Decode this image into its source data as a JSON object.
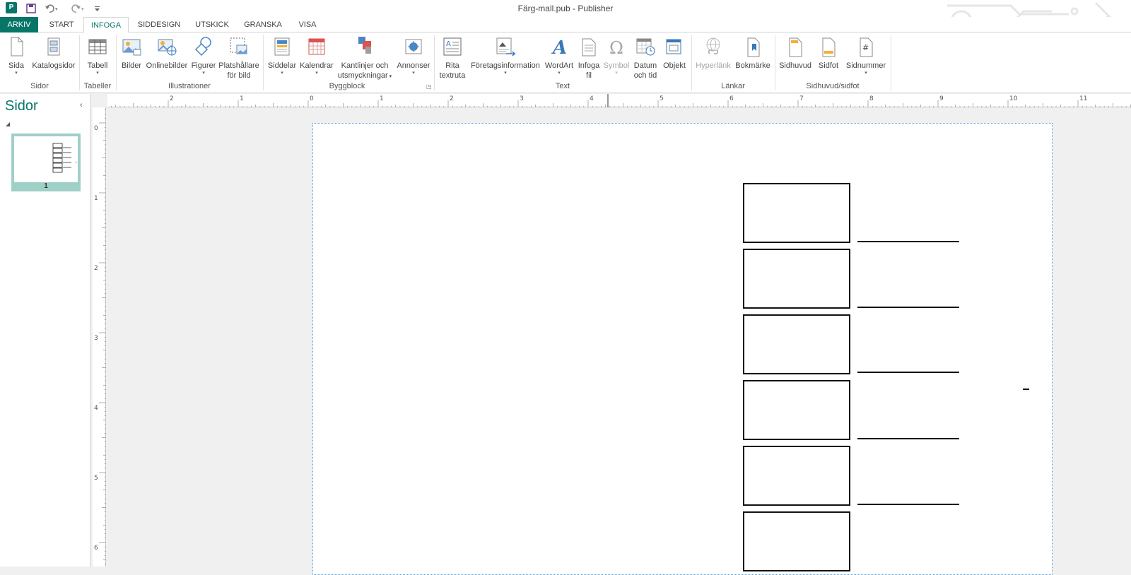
{
  "window": {
    "title": "Färg-mall.pub - Publisher",
    "app_icon_text": "P"
  },
  "qat": {
    "save_icon": "save-icon",
    "undo_icon": "undo-icon",
    "redo_icon": "redo-icon",
    "customize_icon": "customize-qat-icon"
  },
  "tabs": [
    {
      "label": "ARKIV"
    },
    {
      "label": "START"
    },
    {
      "label": "INFOGA"
    },
    {
      "label": "SIDDESIGN"
    },
    {
      "label": "UTSKICK"
    },
    {
      "label": "GRANSKA"
    },
    {
      "label": "VISA"
    }
  ],
  "ribbon": {
    "groups": {
      "sidor": "Sidor",
      "tabeller": "Tabeller",
      "illustrationer": "Illustrationer",
      "byggblock": "Byggblock",
      "text": "Text",
      "lankar": "Länkar",
      "sidhuvud": "Sidhuvud/sidfot"
    },
    "buttons": {
      "sida": "Sida",
      "katalogsidor": "Katalogsidor",
      "tabell": "Tabell",
      "bilder": "Bilder",
      "onlinebilder": "Onlinebilder",
      "figurer": "Figurer",
      "platshallare_1": "Platshållare",
      "platshallare_2": "för bild",
      "siddelar": "Siddelar",
      "kalendrar": "Kalendrar",
      "kantlinjer_1": "Kantlinjer och",
      "kantlinjer_2": "utsmyckningar",
      "annonser": "Annonser",
      "rita_1": "Rita",
      "rita_2": "textruta",
      "foretagsinformation": "Företagsinformation",
      "wordart": "WordArt",
      "infoga_fil_1": "Infoga",
      "infoga_fil_2": "fil",
      "symbol": "Symbol",
      "datum_1": "Datum",
      "datum_2": "och tid",
      "objekt": "Objekt",
      "hyperlank": "Hyperlänk",
      "bokmarke": "Bokmärke",
      "sidhuvud": "Sidhuvud",
      "sidfot": "Sidfot",
      "sidnummer": "Sidnummer"
    }
  },
  "pages_pane": {
    "title": "Sidor",
    "thumbnails": [
      {
        "number": "1"
      }
    ]
  },
  "rulers": {
    "horizontal_labels": [
      "2",
      "1",
      "0",
      "1",
      "2",
      "3",
      "4",
      "5",
      "6",
      "7",
      "8",
      "9",
      "10",
      "11"
    ],
    "vertical_labels": [
      "0",
      "1",
      "2",
      "3",
      "4",
      "5",
      "6"
    ]
  },
  "colors": {
    "accent": "#077568",
    "thumb_selected": "#9fd0c8",
    "page_border": "#5b9bd5"
  }
}
